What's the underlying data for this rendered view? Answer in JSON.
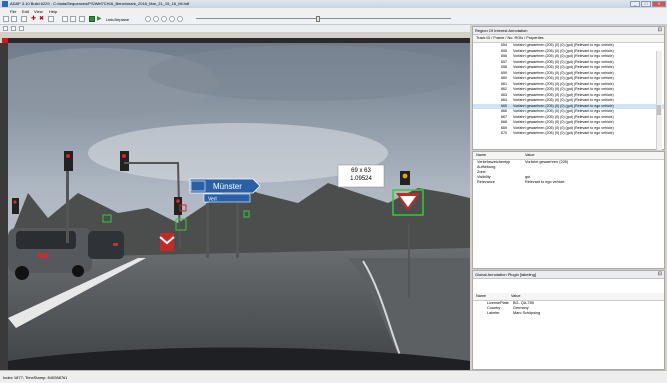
{
  "window": {
    "title": "ADAF 3.10 Build 6229 - C:/data/Sequences/PS/Wel7CH/A_Benchmark_2018_Mar_21_15_16_Mi.hdf",
    "controls": {
      "minimize": "_",
      "maximize": "□",
      "close": "X"
    }
  },
  "menu": [
    "File",
    "Edit",
    "View",
    "Help"
  ],
  "toolbar": {
    "link_label": "Link/Airplane"
  },
  "view": {
    "overlay_text_1": "69 x 63",
    "overlay_text_2": "1.09524",
    "sign_main": "Münster",
    "sign_sub": "Verl"
  },
  "roi_panel": {
    "title": "Region Of Interest Annotation",
    "columns_header": "Track ID / Frame / No. ROIs / Properties",
    "rows": [
      {
        "id": "654",
        "props": "Vorfahrt gewaehren (205) (0) (0) (gut) (Relevant to ego vehicle)"
      },
      {
        "id": "655",
        "props": "Vorfahrt gewaehren (205) (0) (0) (gut) (Relevant to ego vehicle)"
      },
      {
        "id": "656",
        "props": "Vorfahrt gewaehren (205) (0) (0) (gut) (Relevant to ego vehicle)"
      },
      {
        "id": "657",
        "props": "Vorfahrt gewaehren (205) (0) (0) (gut) (Relevant to ego vehicle)"
      },
      {
        "id": "658",
        "props": "Vorfahrt gewaehren (205) (0) (0) (gut) (Relevant to ego vehicle)"
      },
      {
        "id": "659",
        "props": "Vorfahrt gewaehren (205) (0) (0) (gut) (Relevant to ego vehicle)"
      },
      {
        "id": "660",
        "props": "Vorfahrt gewaehren (205) (0) (0) (gut) (Relevant to ego vehicle)"
      },
      {
        "id": "661",
        "props": "Vorfahrt gewaehren (205) (0) (0) (gut) (Relevant to ego vehicle)"
      },
      {
        "id": "662",
        "props": "Vorfahrt gewaehren (205) (0) (0) (gut) (Relevant to ego vehicle)"
      },
      {
        "id": "663",
        "props": "Vorfahrt gewaehren (205) (0) (0) (gut) (Relevant to ego vehicle)"
      },
      {
        "id": "664",
        "props": "Vorfahrt gewaehren (205) (0) (0) (gut) (Relevant to ego vehicle)"
      },
      {
        "id": "665",
        "props": "Vorfahrt gewaehren (205) (0) (0) (gut) (Relevant to ego vehicle)"
      },
      {
        "id": "666",
        "props": "Vorfahrt gewaehren (205) (0) (0) (gut) (Relevant to ego vehicle)"
      },
      {
        "id": "667",
        "props": "Vorfahrt gewaehren (205) (0) (0) (gut) (Relevant to ego vehicle)"
      },
      {
        "id": "668",
        "props": "Vorfahrt gewaehren (205) (0) (0) (gut) (Relevant to ego vehicle)"
      },
      {
        "id": "669",
        "props": "Vorfahrt gewaehren (205) (0) (0) (gut) (Relevant to ego vehicle)"
      },
      {
        "id": "670",
        "props": "Vorfahrt gewaehren (205) (0) (0) (gut) (Relevant to ego vehicle)"
      }
    ],
    "selected_index": 11
  },
  "properties": {
    "name_header": "Name",
    "value_header": "Value",
    "rows": [
      {
        "k": "Verkehrszeichentyp",
        "v": "Vorfahrt gewaehren (205)"
      },
      {
        "k": "Aufhebung",
        "v": ""
      },
      {
        "k": "Zone",
        "v": ""
      },
      {
        "k": "Visibility",
        "v": "gut"
      },
      {
        "k": "Relevance",
        "v": "Relevant to ego vehicle"
      }
    ]
  },
  "global_panel": {
    "title": "Global Annotation Plugin [labeling]",
    "name_header": "Name",
    "value_header": "Value",
    "rows": [
      {
        "k": "LicensePlate",
        "v": "BG- QA-789"
      },
      {
        "k": "Country",
        "v": "Germany"
      },
      {
        "k": "Labeler",
        "v": "Marc Schöpsing"
      }
    ]
  },
  "status": {
    "text": "Index 1877; TimeStamp: 840088761"
  },
  "colors": {
    "accent": "#2a6ab7",
    "roi_box": "#33cc33",
    "marker": "#d01818"
  }
}
